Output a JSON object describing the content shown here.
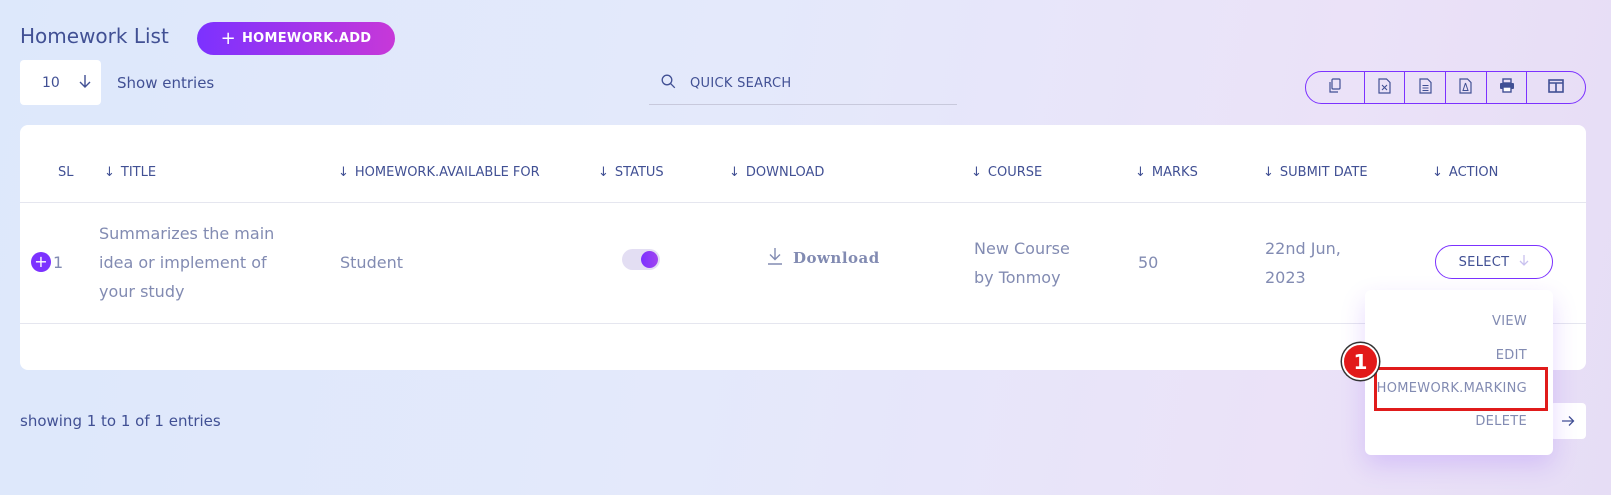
{
  "header": {
    "title": "Homework List",
    "add_button_label": "HOMEWORK.ADD"
  },
  "controls": {
    "entries_value": "10",
    "show_entries_label": "Show entries",
    "search_placeholder": "QUICK SEARCH",
    "export_icons": [
      "copy-icon",
      "excel-icon",
      "csv-icon",
      "pdf-icon",
      "print-icon",
      "columns-icon"
    ]
  },
  "table": {
    "columns": [
      "SL",
      "TITLE",
      "HOMEWORK.AVAILABLE FOR",
      "STATUS",
      "DOWNLOAD",
      "COURSE",
      "MARKS",
      "SUBMIT DATE",
      "ACTION"
    ],
    "rows": [
      {
        "sl": "1",
        "title_lines": [
          "Summarizes the main",
          "idea or implement of",
          "your study"
        ],
        "available_for": "Student",
        "status_on": true,
        "download_label": "Download",
        "course_lines": [
          "New Course",
          "by Tonmoy"
        ],
        "marks": "50",
        "submit_date_lines": [
          "22nd Jun,",
          "2023"
        ],
        "action_label": "SELECT"
      }
    ]
  },
  "dropdown": {
    "items": [
      "VIEW",
      "EDIT",
      "HOMEWORK.MARKING",
      "DELETE"
    ]
  },
  "footer": {
    "showing_text": "showing 1 to 1 of 1 entries"
  },
  "annotation": {
    "step_number": "1",
    "highlight_color": "#e01b1b"
  },
  "colors": {
    "accent": "#7c32ff",
    "accent_end": "#c738d8",
    "text_primary": "#415094",
    "text_muted": "#828bb2"
  }
}
